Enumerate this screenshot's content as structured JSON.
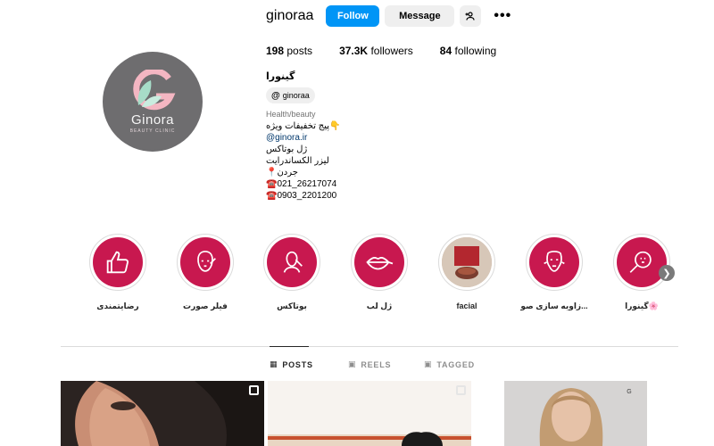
{
  "profile": {
    "username": "ginoraa",
    "follow_label": "Follow",
    "message_label": "Message",
    "stats": {
      "posts_count": "198",
      "posts_label": "posts",
      "followers_count": "37.3K",
      "followers_label": "followers",
      "following_count": "84",
      "following_label": "following"
    }
  },
  "avatar": {
    "brand": "Ginora",
    "subtitle": "BEAUTY CLINIC"
  },
  "bio": {
    "name": "گینورا",
    "threads_handle": "ginoraa",
    "category": "Health/beauty",
    "line1": "پیج تخفیفات ویژه👇",
    "link": "@ginora.ir",
    "line2": "ژل بوتاکس",
    "line3": "لیزر الکساندرایت",
    "line4": "📍جردن",
    "phone1": "☎️021_26217074",
    "phone2": "☎️0903_2201200"
  },
  "highlights": [
    {
      "label": "رضایتمندی",
      "icon": "thumbs-up-icon"
    },
    {
      "label": "فیلر صورت",
      "icon": "face-filler-icon"
    },
    {
      "label": "بوتاکس",
      "icon": "botox-icon"
    },
    {
      "label": "ژل لب",
      "icon": "lips-icon"
    },
    {
      "label": "facial",
      "icon": "photo"
    },
    {
      "label": "زاویه سازی صو...",
      "icon": "face-contour-icon"
    },
    {
      "label": "گینورا🌸",
      "icon": "magnifier-face-icon"
    }
  ],
  "tabs": {
    "posts": "POSTS",
    "reels": "REELS",
    "tagged": "TAGGED"
  },
  "colors": {
    "follow_button": "#0095f6",
    "highlight_bg": "#c8184f",
    "avatar_bg": "#6e6d6f",
    "logo_pink": "#f4b6c2",
    "logo_green": "#a7dcc8"
  }
}
